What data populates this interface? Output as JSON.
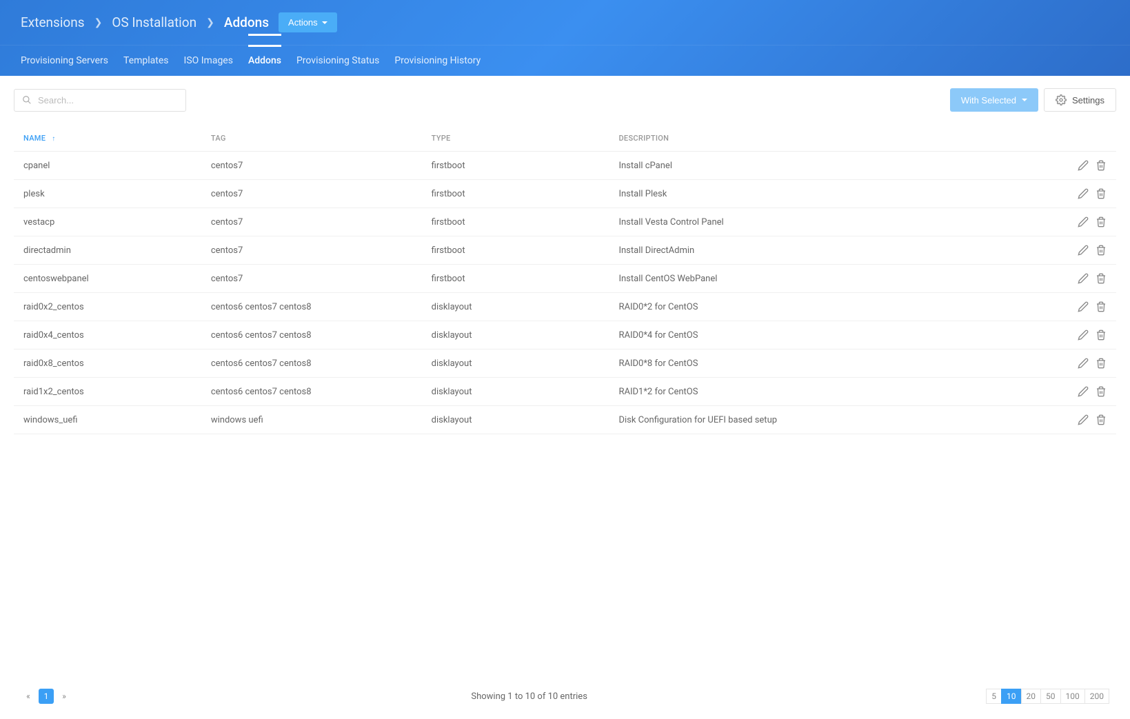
{
  "breadcrumb": {
    "items": [
      "Extensions",
      "OS Installation",
      "Addons"
    ],
    "activeIndex": 2
  },
  "actionsButton": {
    "label": "Actions"
  },
  "tabs": {
    "items": [
      {
        "label": "Provisioning Servers"
      },
      {
        "label": "Templates"
      },
      {
        "label": "ISO Images"
      },
      {
        "label": "Addons"
      },
      {
        "label": "Provisioning Status"
      },
      {
        "label": "Provisioning History"
      }
    ],
    "activeIndex": 3
  },
  "search": {
    "placeholder": "Search..."
  },
  "toolbar": {
    "withSelected": "With Selected",
    "settings": "Settings"
  },
  "table": {
    "columns": [
      {
        "label": "Name",
        "sorted": true
      },
      {
        "label": "Tag"
      },
      {
        "label": "Type"
      },
      {
        "label": "Description"
      }
    ],
    "rows": [
      {
        "name": "cpanel",
        "tag": "centos7",
        "type": "firstboot",
        "description": "Install cPanel"
      },
      {
        "name": "plesk",
        "tag": "centos7",
        "type": "firstboot",
        "description": "Install Plesk"
      },
      {
        "name": "vestacp",
        "tag": "centos7",
        "type": "firstboot",
        "description": "Install Vesta Control Panel"
      },
      {
        "name": "directadmin",
        "tag": "centos7",
        "type": "firstboot",
        "description": "Install DirectAdmin"
      },
      {
        "name": "centoswebpanel",
        "tag": "centos7",
        "type": "firstboot",
        "description": "Install CentOS WebPanel"
      },
      {
        "name": "raid0x2_centos",
        "tag": "centos6 centos7 centos8",
        "type": "disklayout",
        "description": "RAID0*2 for CentOS"
      },
      {
        "name": "raid0x4_centos",
        "tag": "centos6 centos7 centos8",
        "type": "disklayout",
        "description": "RAID0*4 for CentOS"
      },
      {
        "name": "raid0x8_centos",
        "tag": "centos6 centos7 centos8",
        "type": "disklayout",
        "description": "RAID0*8 for CentOS"
      },
      {
        "name": "raid1x2_centos",
        "tag": "centos6 centos7 centos8",
        "type": "disklayout",
        "description": "RAID1*2 for CentOS"
      },
      {
        "name": "windows_uefi",
        "tag": "windows uefi",
        "type": "disklayout",
        "description": "Disk Configuration for UEFI based setup"
      }
    ]
  },
  "footer": {
    "summary": "Showing 1 to 10 of 10 entries",
    "currentPage": "1",
    "pageSizes": [
      "5",
      "10",
      "20",
      "50",
      "100",
      "200"
    ],
    "activeSize": "10"
  }
}
